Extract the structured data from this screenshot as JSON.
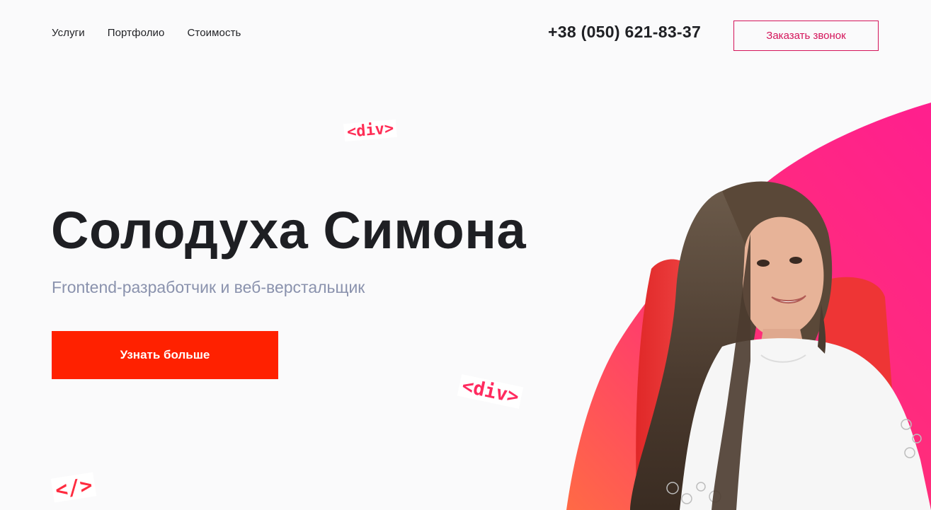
{
  "nav": {
    "items": [
      {
        "label": "Услуги"
      },
      {
        "label": "Портфолио"
      },
      {
        "label": "Стоимость"
      }
    ]
  },
  "contact": {
    "phone": "+38 (050) 621-83-37",
    "callback_label": "Заказать звонок"
  },
  "hero": {
    "title": "Солодуха Симона",
    "subtitle": "Frontend-разработчик и веб-верстальщик",
    "cta_label": "Узнать больше"
  },
  "decor": {
    "tag_div": "<div>",
    "tag_close": "</>"
  },
  "colors": {
    "accent": "#d4145a",
    "cta": "#ff2100",
    "blob_start": "#ff1f8e",
    "blob_end": "#ff6a45",
    "subtitle": "#8a92ad",
    "text": "#1e1f23"
  }
}
